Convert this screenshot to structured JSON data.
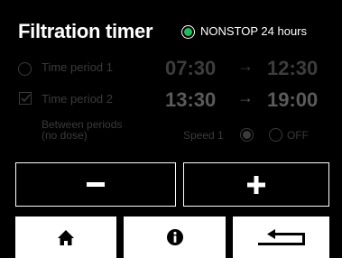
{
  "header": {
    "title": "Filtration timer",
    "nonstop_label": "NONSTOP 24 hours",
    "nonstop_selected": true
  },
  "periods": [
    {
      "label": "Time period 1",
      "start": "07:30",
      "arrow": "→",
      "end": "12:30",
      "enabled": false
    },
    {
      "label": "Time period 2",
      "start": "13:30",
      "arrow": "→",
      "end": "19:00",
      "enabled": true
    }
  ],
  "between": {
    "label_line1": "Between periods",
    "label_line2": "(no dose)",
    "speed_label": "Speed 1",
    "off_label": "OFF",
    "selected": "speed1"
  },
  "controls": {
    "minus_label": "−",
    "plus_label": "+"
  },
  "nav": {
    "home_icon": "home-icon",
    "info_icon": "info-icon",
    "back_icon": "back-arrow-icon"
  },
  "colors": {
    "background": "#000000",
    "foreground": "#ffffff",
    "accent_green": "#18c05a",
    "disabled": "#3a3a3a"
  }
}
